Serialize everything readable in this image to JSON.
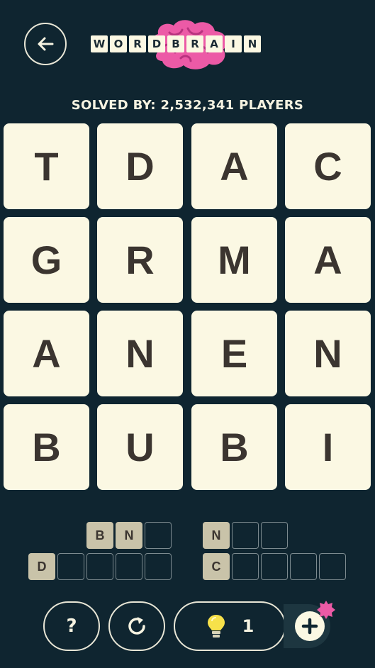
{
  "header": {
    "back_icon": "arrow-left-icon",
    "logo_left": [
      "W",
      "O",
      "R",
      "D"
    ],
    "logo_right": [
      "B",
      "R",
      "A",
      "I",
      "N"
    ],
    "logo_colors": {
      "brain": "#ec5aa6",
      "tile": "#fbf8e3"
    }
  },
  "solved_text": "SOLVED BY: 2,532,341 PLAYERS",
  "board": [
    [
      "T",
      "D",
      "A",
      "C"
    ],
    [
      "G",
      "R",
      "M",
      "A"
    ],
    [
      "A",
      "N",
      "E",
      "N"
    ],
    [
      "B",
      "U",
      "B",
      "I"
    ]
  ],
  "answers": [
    {
      "letters": [
        "B",
        "N",
        ""
      ]
    },
    {
      "letters": [
        "N",
        "",
        ""
      ]
    },
    {
      "letters": [
        "D",
        "",
        "",
        "",
        ""
      ]
    },
    {
      "letters": [
        "C",
        "",
        "",
        "",
        ""
      ]
    }
  ],
  "controls": {
    "help_label": "?",
    "hint_count": "1",
    "icons": [
      "question-icon",
      "refresh-icon",
      "lightbulb-icon",
      "plus-icon",
      "star-badge-icon"
    ]
  },
  "colors": {
    "background": "#0f2530",
    "tile": "#fbf8e3",
    "filled_slot": "#c9c3a9"
  }
}
